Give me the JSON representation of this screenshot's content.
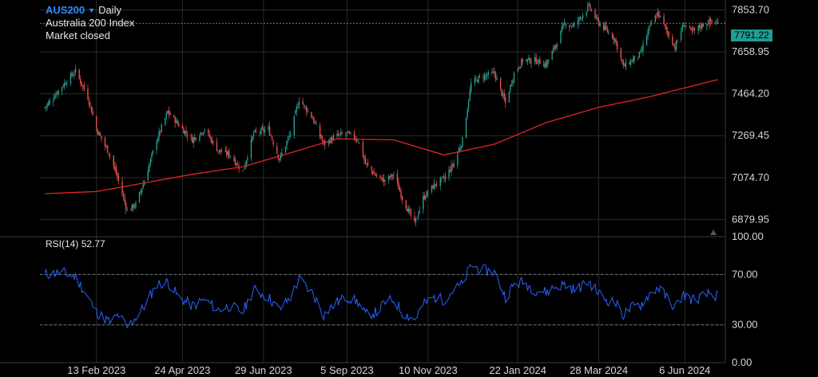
{
  "header": {
    "symbol": "AUS200",
    "interval": "Daily",
    "index_name": "Australia 200 Index",
    "market_status": "Market closed"
  },
  "colors": {
    "background": "#000000",
    "grid": "#2a2a2a",
    "candle_up": "#26a69a",
    "candle_down": "#ef5350",
    "moving_average": "#e02424",
    "rsi_line": "#2962ff",
    "last_price_tag": "#1f9c93",
    "symbol_accent": "#2f8cff"
  },
  "chart_data": [
    {
      "type": "candlestick",
      "name": "price",
      "ylim": [
        6800,
        7900
      ],
      "y_ticks": [
        "7853.70",
        "7658.95",
        "7464.20",
        "7269.45",
        "7074.70",
        "6879.95"
      ],
      "x_ticks": [
        "13 Feb 2023",
        "24 Apr 2023",
        "29 Jun 2023",
        "5 Sep 2023",
        "10 Nov 2023",
        "22 Jan 2024",
        "28 Mar 2024",
        "6 Jun 2024"
      ],
      "last_price": "7791.22",
      "close_points": [
        {
          "x": "2023-01-02",
          "y": 7400
        },
        {
          "x": "2023-01-16",
          "y": 7500
        },
        {
          "x": "2023-01-27",
          "y": 7570
        },
        {
          "x": "2023-02-06",
          "y": 7450
        },
        {
          "x": "2023-02-13",
          "y": 7300
        },
        {
          "x": "2023-02-24",
          "y": 7180
        },
        {
          "x": "2023-03-03",
          "y": 7060
        },
        {
          "x": "2023-03-10",
          "y": 6920
        },
        {
          "x": "2023-03-17",
          "y": 6950
        },
        {
          "x": "2023-03-24",
          "y": 7060
        },
        {
          "x": "2023-04-03",
          "y": 7250
        },
        {
          "x": "2023-04-12",
          "y": 7380
        },
        {
          "x": "2023-04-21",
          "y": 7320
        },
        {
          "x": "2023-05-02",
          "y": 7250
        },
        {
          "x": "2023-05-12",
          "y": 7300
        },
        {
          "x": "2023-05-23",
          "y": 7200
        },
        {
          "x": "2023-06-02",
          "y": 7180
        },
        {
          "x": "2023-06-12",
          "y": 7100
        },
        {
          "x": "2023-06-21",
          "y": 7280
        },
        {
          "x": "2023-07-03",
          "y": 7300
        },
        {
          "x": "2023-07-12",
          "y": 7160
        },
        {
          "x": "2023-07-21",
          "y": 7280
        },
        {
          "x": "2023-07-28",
          "y": 7440
        },
        {
          "x": "2023-08-08",
          "y": 7350
        },
        {
          "x": "2023-08-17",
          "y": 7230
        },
        {
          "x": "2023-08-28",
          "y": 7270
        },
        {
          "x": "2023-09-05",
          "y": 7280
        },
        {
          "x": "2023-09-14",
          "y": 7250
        },
        {
          "x": "2023-09-20",
          "y": 7140
        },
        {
          "x": "2023-09-29",
          "y": 7080
        },
        {
          "x": "2023-10-06",
          "y": 7060
        },
        {
          "x": "2023-10-13",
          "y": 7090
        },
        {
          "x": "2023-10-20",
          "y": 6980
        },
        {
          "x": "2023-10-30",
          "y": 6860
        },
        {
          "x": "2023-11-06",
          "y": 6980
        },
        {
          "x": "2023-11-15",
          "y": 7040
        },
        {
          "x": "2023-11-23",
          "y": 7070
        },
        {
          "x": "2023-12-01",
          "y": 7140
        },
        {
          "x": "2023-12-08",
          "y": 7250
        },
        {
          "x": "2023-12-15",
          "y": 7510
        },
        {
          "x": "2023-12-22",
          "y": 7540
        },
        {
          "x": "2024-01-03",
          "y": 7560
        },
        {
          "x": "2024-01-12",
          "y": 7420
        },
        {
          "x": "2024-01-19",
          "y": 7560
        },
        {
          "x": "2024-01-26",
          "y": 7620
        },
        {
          "x": "2024-02-05",
          "y": 7620
        },
        {
          "x": "2024-02-14",
          "y": 7600
        },
        {
          "x": "2024-02-21",
          "y": 7680
        },
        {
          "x": "2024-02-29",
          "y": 7790
        },
        {
          "x": "2024-03-08",
          "y": 7780
        },
        {
          "x": "2024-03-13",
          "y": 7820
        },
        {
          "x": "2024-03-20",
          "y": 7870
        },
        {
          "x": "2024-03-27",
          "y": 7800
        },
        {
          "x": "2024-04-03",
          "y": 7760
        },
        {
          "x": "2024-04-10",
          "y": 7720
        },
        {
          "x": "2024-04-17",
          "y": 7590
        },
        {
          "x": "2024-04-24",
          "y": 7620
        },
        {
          "x": "2024-05-01",
          "y": 7650
        },
        {
          "x": "2024-05-08",
          "y": 7770
        },
        {
          "x": "2024-05-15",
          "y": 7840
        },
        {
          "x": "2024-05-22",
          "y": 7760
        },
        {
          "x": "2024-05-29",
          "y": 7680
        },
        {
          "x": "2024-06-05",
          "y": 7790
        },
        {
          "x": "2024-06-12",
          "y": 7750
        },
        {
          "x": "2024-06-19",
          "y": 7780
        },
        {
          "x": "2024-06-26",
          "y": 7800
        },
        {
          "x": "2024-07-03",
          "y": 7791
        }
      ],
      "moving_average": [
        {
          "x": "2023-01-02",
          "y": 7000
        },
        {
          "x": "2023-02-13",
          "y": 7010
        },
        {
          "x": "2023-03-24",
          "y": 7050
        },
        {
          "x": "2023-05-02",
          "y": 7090
        },
        {
          "x": "2023-06-12",
          "y": 7125
        },
        {
          "x": "2023-07-21",
          "y": 7190
        },
        {
          "x": "2023-08-28",
          "y": 7255
        },
        {
          "x": "2023-10-13",
          "y": 7250
        },
        {
          "x": "2023-11-23",
          "y": 7180
        },
        {
          "x": "2024-01-03",
          "y": 7230
        },
        {
          "x": "2024-02-14",
          "y": 7330
        },
        {
          "x": "2024-03-27",
          "y": 7400
        },
        {
          "x": "2024-05-08",
          "y": 7450
        },
        {
          "x": "2024-06-19",
          "y": 7510
        },
        {
          "x": "2024-07-03",
          "y": 7530
        }
      ]
    },
    {
      "type": "line",
      "name": "rsi",
      "label": "RSI(14)",
      "value": "52.77",
      "ylim": [
        0,
        100
      ],
      "y_ticks": [
        "100.00",
        "70.00",
        "30.00",
        "0.00"
      ],
      "levels": [
        70,
        30
      ],
      "points": [
        {
          "x": "2023-01-02",
          "y": 70
        },
        {
          "x": "2023-01-16",
          "y": 72
        },
        {
          "x": "2023-01-27",
          "y": 68
        },
        {
          "x": "2023-02-06",
          "y": 52
        },
        {
          "x": "2023-02-13",
          "y": 40
        },
        {
          "x": "2023-02-24",
          "y": 32
        },
        {
          "x": "2023-03-03",
          "y": 38
        },
        {
          "x": "2023-03-10",
          "y": 28
        },
        {
          "x": "2023-03-17",
          "y": 36
        },
        {
          "x": "2023-03-24",
          "y": 45
        },
        {
          "x": "2023-04-03",
          "y": 62
        },
        {
          "x": "2023-04-12",
          "y": 64
        },
        {
          "x": "2023-04-21",
          "y": 52
        },
        {
          "x": "2023-05-02",
          "y": 45
        },
        {
          "x": "2023-05-12",
          "y": 50
        },
        {
          "x": "2023-05-23",
          "y": 42
        },
        {
          "x": "2023-06-02",
          "y": 45
        },
        {
          "x": "2023-06-12",
          "y": 40
        },
        {
          "x": "2023-06-21",
          "y": 58
        },
        {
          "x": "2023-07-03",
          "y": 52
        },
        {
          "x": "2023-07-12",
          "y": 42
        },
        {
          "x": "2023-07-21",
          "y": 52
        },
        {
          "x": "2023-07-28",
          "y": 66
        },
        {
          "x": "2023-08-08",
          "y": 55
        },
        {
          "x": "2023-08-17",
          "y": 38
        },
        {
          "x": "2023-08-28",
          "y": 48
        },
        {
          "x": "2023-09-05",
          "y": 52
        },
        {
          "x": "2023-09-14",
          "y": 48
        },
        {
          "x": "2023-09-20",
          "y": 38
        },
        {
          "x": "2023-09-29",
          "y": 40
        },
        {
          "x": "2023-10-06",
          "y": 48
        },
        {
          "x": "2023-10-13",
          "y": 50
        },
        {
          "x": "2023-10-20",
          "y": 40
        },
        {
          "x": "2023-10-30",
          "y": 34
        },
        {
          "x": "2023-11-06",
          "y": 46
        },
        {
          "x": "2023-11-15",
          "y": 52
        },
        {
          "x": "2023-11-23",
          "y": 50
        },
        {
          "x": "2023-12-01",
          "y": 58
        },
        {
          "x": "2023-12-08",
          "y": 62
        },
        {
          "x": "2023-12-15",
          "y": 78
        },
        {
          "x": "2023-12-22",
          "y": 74
        },
        {
          "x": "2024-01-03",
          "y": 72
        },
        {
          "x": "2024-01-12",
          "y": 52
        },
        {
          "x": "2024-01-19",
          "y": 62
        },
        {
          "x": "2024-01-26",
          "y": 64
        },
        {
          "x": "2024-02-05",
          "y": 58
        },
        {
          "x": "2024-02-14",
          "y": 56
        },
        {
          "x": "2024-02-21",
          "y": 60
        },
        {
          "x": "2024-02-29",
          "y": 62
        },
        {
          "x": "2024-03-08",
          "y": 58
        },
        {
          "x": "2024-03-13",
          "y": 60
        },
        {
          "x": "2024-03-20",
          "y": 64
        },
        {
          "x": "2024-03-27",
          "y": 56
        },
        {
          "x": "2024-04-03",
          "y": 50
        },
        {
          "x": "2024-04-10",
          "y": 48
        },
        {
          "x": "2024-04-17",
          "y": 38
        },
        {
          "x": "2024-04-24",
          "y": 44
        },
        {
          "x": "2024-05-01",
          "y": 46
        },
        {
          "x": "2024-05-08",
          "y": 54
        },
        {
          "x": "2024-05-15",
          "y": 60
        },
        {
          "x": "2024-05-22",
          "y": 52
        },
        {
          "x": "2024-05-29",
          "y": 44
        },
        {
          "x": "2024-06-05",
          "y": 54
        },
        {
          "x": "2024-06-12",
          "y": 50
        },
        {
          "x": "2024-06-19",
          "y": 52
        },
        {
          "x": "2024-06-26",
          "y": 55
        },
        {
          "x": "2024-07-03",
          "y": 52.77
        }
      ]
    }
  ]
}
